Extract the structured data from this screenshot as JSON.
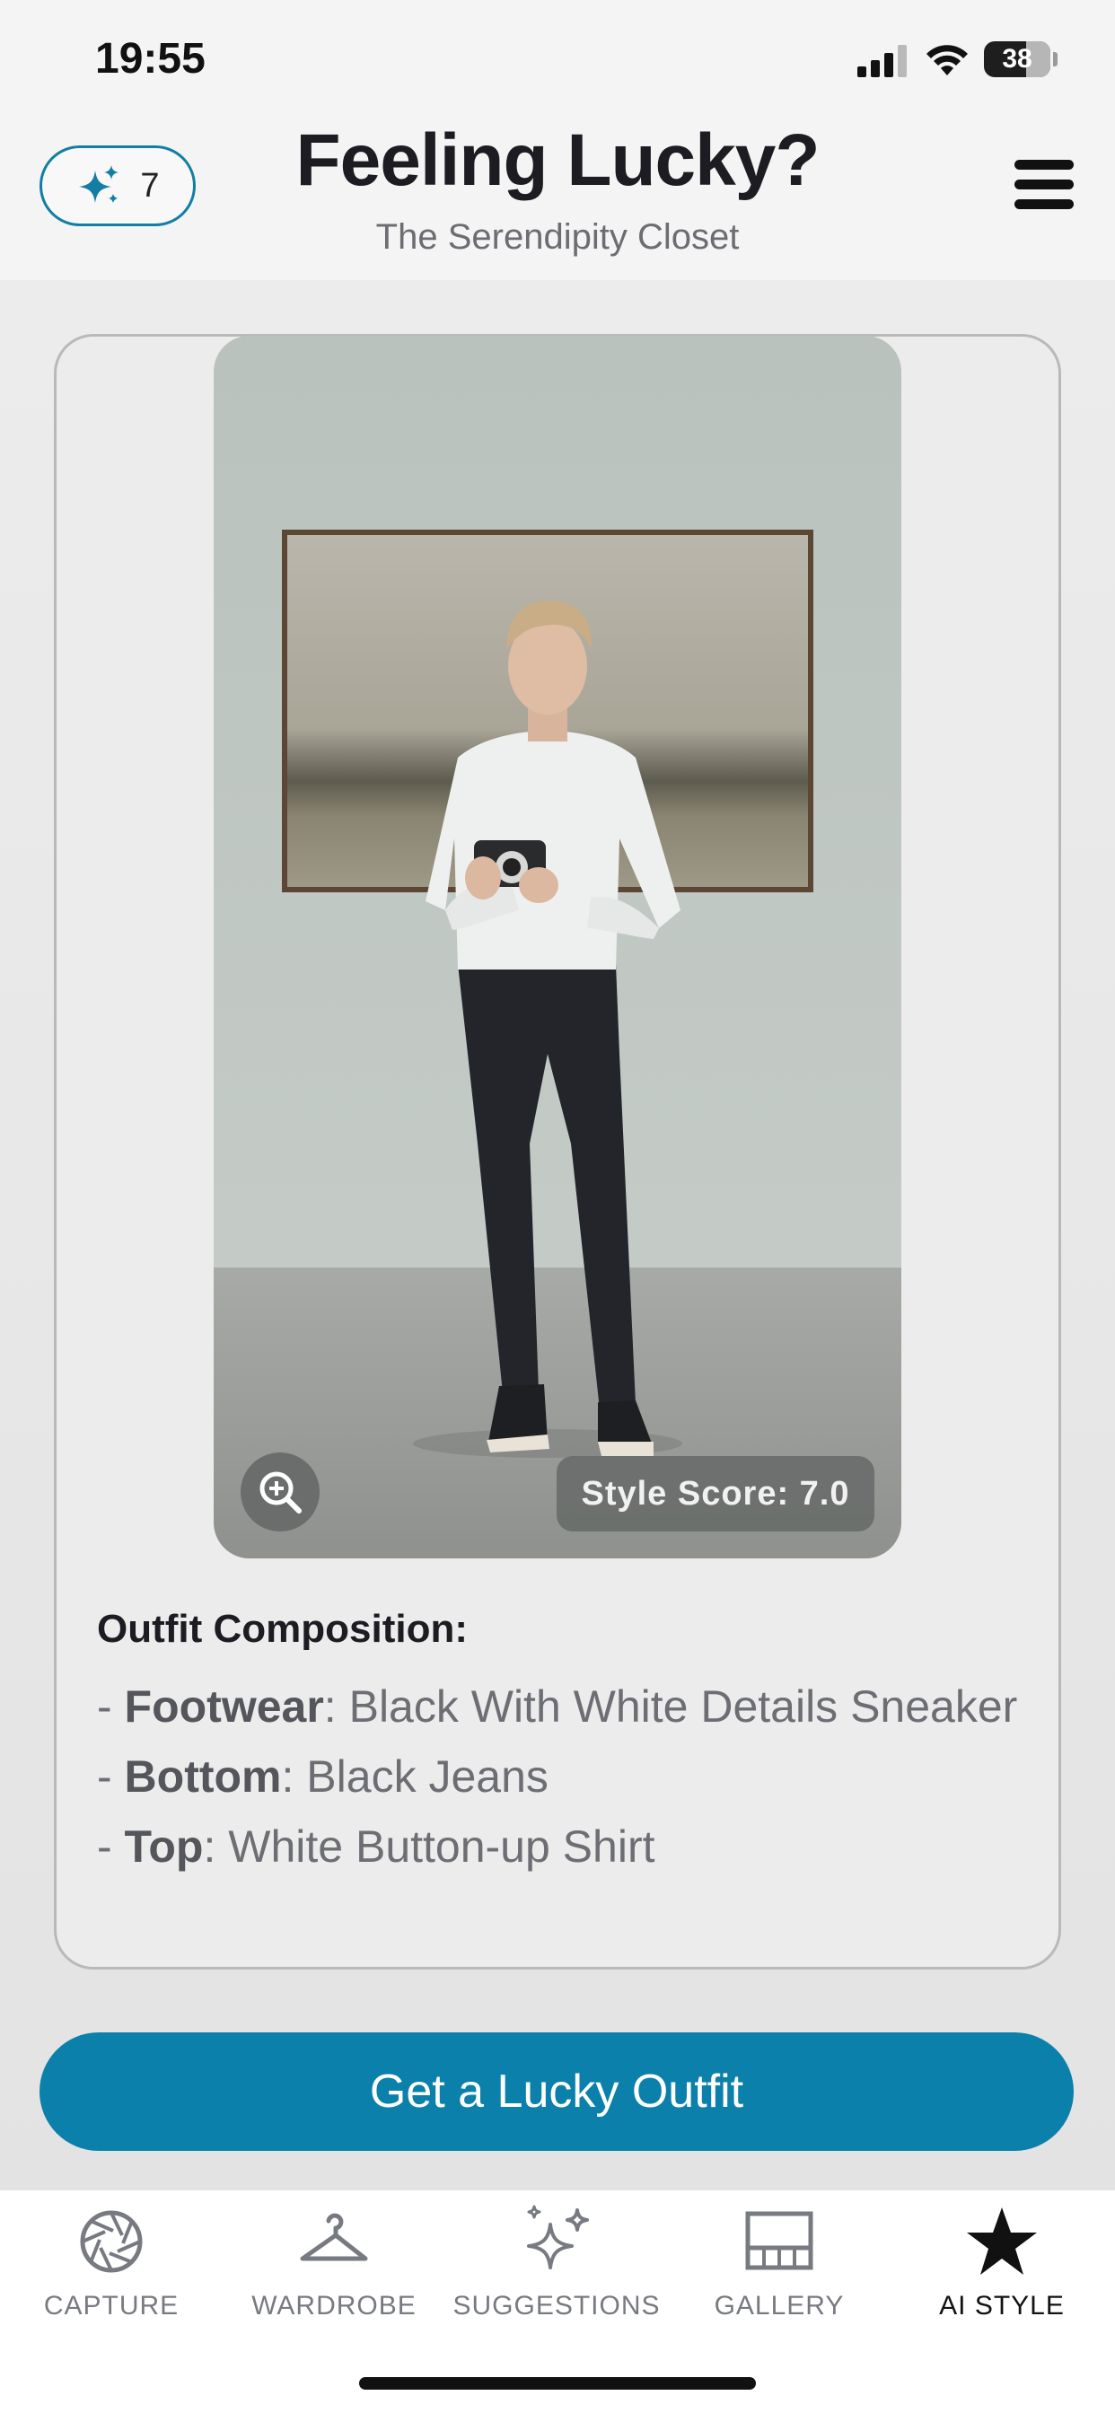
{
  "status_bar": {
    "time": "19:55",
    "battery": "38"
  },
  "header": {
    "credits_count": "7",
    "credits_icon": "sparkles-icon",
    "title": "Feeling Lucky?",
    "subtitle": "The Serendipity Closet",
    "menu_icon": "hamburger-menu-icon"
  },
  "outfit": {
    "style_score": "Style Score: 7.0",
    "zoom_icon": "zoom-in-icon",
    "composition_title": "Outfit Composition:",
    "items": [
      {
        "prefix": "- ",
        "category": "Footwear",
        "separator": ": ",
        "description": "Black With White Details Sneaker"
      },
      {
        "prefix": "- ",
        "category": "Bottom",
        "separator": ": ",
        "description": "Black Jeans"
      },
      {
        "prefix": "- ",
        "category": "Top",
        "separator": ": ",
        "description": "White Button-up Shirt"
      }
    ]
  },
  "cta": {
    "label": "Get a Lucky Outfit"
  },
  "colors": {
    "accent": "#0b80aa",
    "pill_border": "#137ea3"
  },
  "tabs": [
    {
      "label": "CAPTURE",
      "icon": "aperture-icon",
      "active": false
    },
    {
      "label": "WARDROBE",
      "icon": "hanger-icon",
      "active": false
    },
    {
      "label": "SUGGESTIONS",
      "icon": "sparkles-icon",
      "active": false
    },
    {
      "label": "GALLERY",
      "icon": "gallery-icon",
      "active": false
    },
    {
      "label": "AI STYLE",
      "icon": "star-icon",
      "active": true
    }
  ]
}
